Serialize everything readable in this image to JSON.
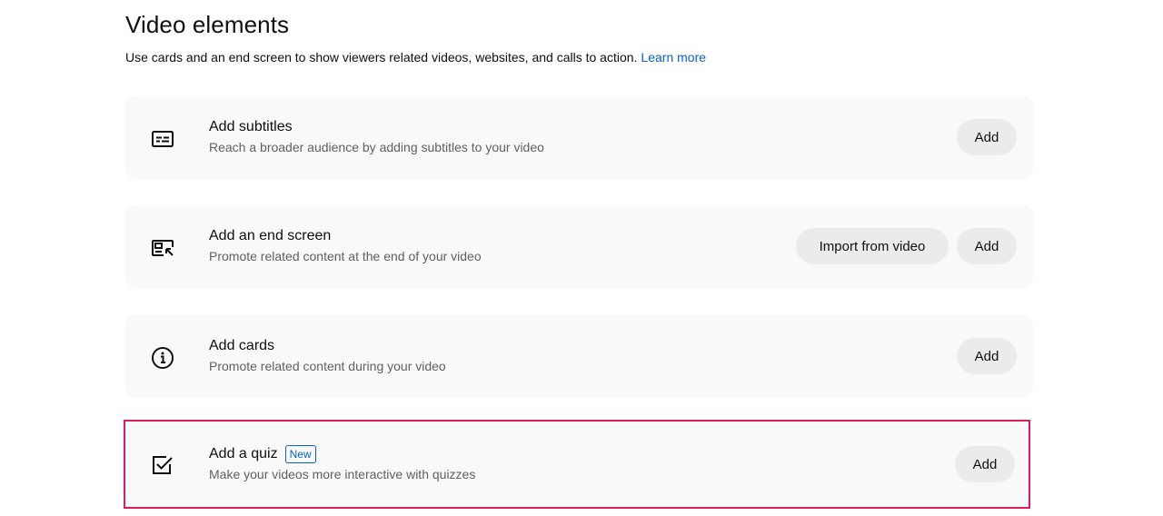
{
  "header": {
    "title": "Video elements",
    "description": "Use cards and an end screen to show viewers related videos, websites, and calls to action.",
    "learn_more": "Learn more"
  },
  "items": [
    {
      "title": "Add subtitles",
      "description": "Reach a broader audience by adding subtitles to your video",
      "icon": "subtitles-icon",
      "add_label": "Add"
    },
    {
      "title": "Add an end screen",
      "description": "Promote related content at the end of your video",
      "icon": "end-screen-icon",
      "import_label": "Import from video",
      "add_label": "Add"
    },
    {
      "title": "Add cards",
      "description": "Promote related content during your video",
      "icon": "info-icon",
      "add_label": "Add"
    },
    {
      "title": "Add a quiz",
      "badge": "New",
      "description": "Make your videos more interactive with quizzes",
      "icon": "checkbox-icon",
      "add_label": "Add"
    }
  ],
  "colors": {
    "link": "#065fd4",
    "highlight_border": "#dc1c5c",
    "card_bg": "#f9f9f9",
    "button_bg": "#ebebeb"
  }
}
